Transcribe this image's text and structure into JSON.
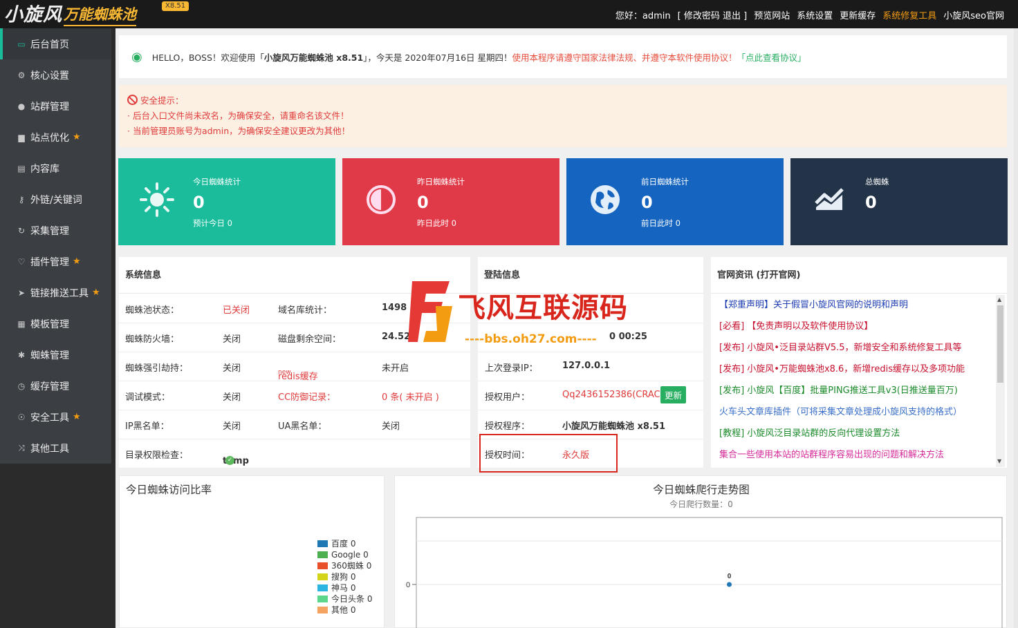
{
  "header": {
    "logo_main": "小旋风",
    "logo_sub": "万能蜘蛛池",
    "version": "X8.51",
    "greeting": "您好：admin",
    "account_links": "[ 修改密码 退出 ]",
    "nav": [
      "预览网站",
      "系统设置",
      "更新缓存",
      "系统修复工具",
      "小旋风seo官网"
    ]
  },
  "sidebar": {
    "items": [
      {
        "label": "后台首页",
        "icon": "monitor-icon",
        "star": false
      },
      {
        "label": "核心设置",
        "icon": "gear-icon",
        "star": false
      },
      {
        "label": "站群管理",
        "icon": "user-icon",
        "star": false
      },
      {
        "label": "站点优化",
        "icon": "bar-chart-icon",
        "star": true
      },
      {
        "label": "内容库",
        "icon": "document-icon",
        "star": false
      },
      {
        "label": "外链/关键词",
        "icon": "key-icon",
        "star": false
      },
      {
        "label": "采集管理",
        "icon": "refresh-icon",
        "star": false
      },
      {
        "label": "插件管理",
        "icon": "trophy-icon",
        "star": true
      },
      {
        "label": "链接推送工具",
        "icon": "send-icon",
        "star": true
      },
      {
        "label": "模板管理",
        "icon": "grid-icon",
        "star": false
      },
      {
        "label": "蜘蛛管理",
        "icon": "bug-icon",
        "star": false
      },
      {
        "label": "缓存管理",
        "icon": "clock-icon",
        "star": false
      },
      {
        "label": "安全工具",
        "icon": "bulb-icon",
        "star": true
      },
      {
        "label": "其他工具",
        "icon": "shuffle-icon",
        "star": false
      }
    ]
  },
  "welcome": {
    "hello": "HELLO，BOSS！欢迎使用「",
    "product": "小旋风万能蜘蛛池 x8.51",
    "date_text": "」，今天是 2020年07月16日 星期四！",
    "law_notice": "使用本程序请遵守国家法律法规、并遵守本软件使用协议！",
    "agreement_link": "「点此查看协议」"
  },
  "security": {
    "title": "安全提示：",
    "lines": [
      "· 后台入口文件尚未改名，为确保安全，请重命名该文件！",
      "· 当前管理员账号为admin，为确保安全建议更改为其他！"
    ]
  },
  "cards": [
    {
      "title": "今日蜘蛛统计",
      "value": "0",
      "sub": "预计今日 0",
      "color": "#1abc9c",
      "icon": "sun-icon"
    },
    {
      "title": "昨日蜘蛛统计",
      "value": "0",
      "sub": "昨日此时 0",
      "color": "#e03a48",
      "icon": "half-circle-icon"
    },
    {
      "title": "前日蜘蛛统计",
      "value": "0",
      "sub": "前日此时 0",
      "color": "#1565c0",
      "icon": "globe-icon"
    },
    {
      "title": "总蜘蛛",
      "value": "0",
      "sub": "",
      "color": "#243448",
      "icon": "trend-icon"
    }
  ],
  "sysinfo": {
    "title": "系统信息",
    "rows": [
      [
        "蜘蛛池状态：",
        "已关闭",
        "域名库统计：",
        "1498"
      ],
      [
        "蜘蛛防火墙：",
        "关闭",
        "磁盘剩余空间：",
        "24.52"
      ],
      [
        "蜘蛛强引劫持：",
        "关闭",
        "redis缓存",
        "未开启"
      ],
      [
        "调试模式：",
        "关闭",
        "CC防御记录：",
        "0 条( 未开启 )"
      ],
      [
        "IP黑名单：",
        "关闭",
        "UA黑名单：",
        "关闭"
      ],
      [
        "目录权限检查：",
        "temp",
        "",
        ""
      ]
    ],
    "redis_sup": "new"
  },
  "login": {
    "title": "登陆信息",
    "time_partial": "0 00:25",
    "last_ip_label": "上次登录IP：",
    "last_ip": "127.0.0.1",
    "user_label": "授权用户：",
    "user": "Qq2436152386(CRACK)",
    "update_btn": "更新",
    "program_label": "授权程序：",
    "program": "小旋风万能蜘蛛池 x8.51",
    "auth_label": "授权时间：",
    "auth_value": "永久版"
  },
  "news": {
    "title": "官网资讯 (打开官网)",
    "items": [
      {
        "text": "【郑重声明】关于假冒小旋风官网的说明和声明",
        "cls": "n-blue"
      },
      {
        "text": "[必看] 【免责声明以及软件使用协议】",
        "cls": "n-red"
      },
      {
        "text": "[发布] 小旋风•泛目录站群V5.5，新增安全和系统修复工具等",
        "cls": "n-red"
      },
      {
        "text": "[发布] 小旋风•万能蜘蛛池x8.6，新增redis缓存以及多项功能",
        "cls": "n-red"
      },
      {
        "text": "[发布] 小旋风【百度】批量PING推送工具v3(日推送量百万)",
        "cls": "n-green"
      },
      {
        "text": "火车头文章库插件（可将采集文章处理成小旋风支持的格式）",
        "cls": "n-lblue"
      },
      {
        "text": "[教程] 小旋风泛目录站群的反向代理设置方法",
        "cls": "n-green"
      },
      {
        "text": "集合一些使用本站的站群程序容易出现的问题和解决方法",
        "cls": "n-mag"
      }
    ]
  },
  "watermark": {
    "text": "飞风互联源码",
    "url": "----bbs.oh27.com----"
  },
  "pie_chart": {
    "title": "今日蜘蛛访问比率",
    "legend": [
      {
        "label": "百度 0",
        "color": "#1f77b4"
      },
      {
        "label": "Google 0",
        "color": "#4caf50"
      },
      {
        "label": "360蜘蛛 0",
        "color": "#e8502a"
      },
      {
        "label": "搜狗 0",
        "color": "#d4d41a"
      },
      {
        "label": "神马 0",
        "color": "#2bb5e0"
      },
      {
        "label": "今日头条 0",
        "color": "#5cd68a"
      },
      {
        "label": "其他 0",
        "color": "#f4a460"
      }
    ]
  },
  "chart_data": {
    "type": "line",
    "title": "今日蜘蛛爬行走势图",
    "subtitle": "今日爬行数量：0",
    "x": [
      0
    ],
    "series": [
      {
        "values": [
          0
        ]
      }
    ],
    "y_tick_labels": [
      "0"
    ],
    "point_labels": [
      "0"
    ],
    "grid": true
  }
}
